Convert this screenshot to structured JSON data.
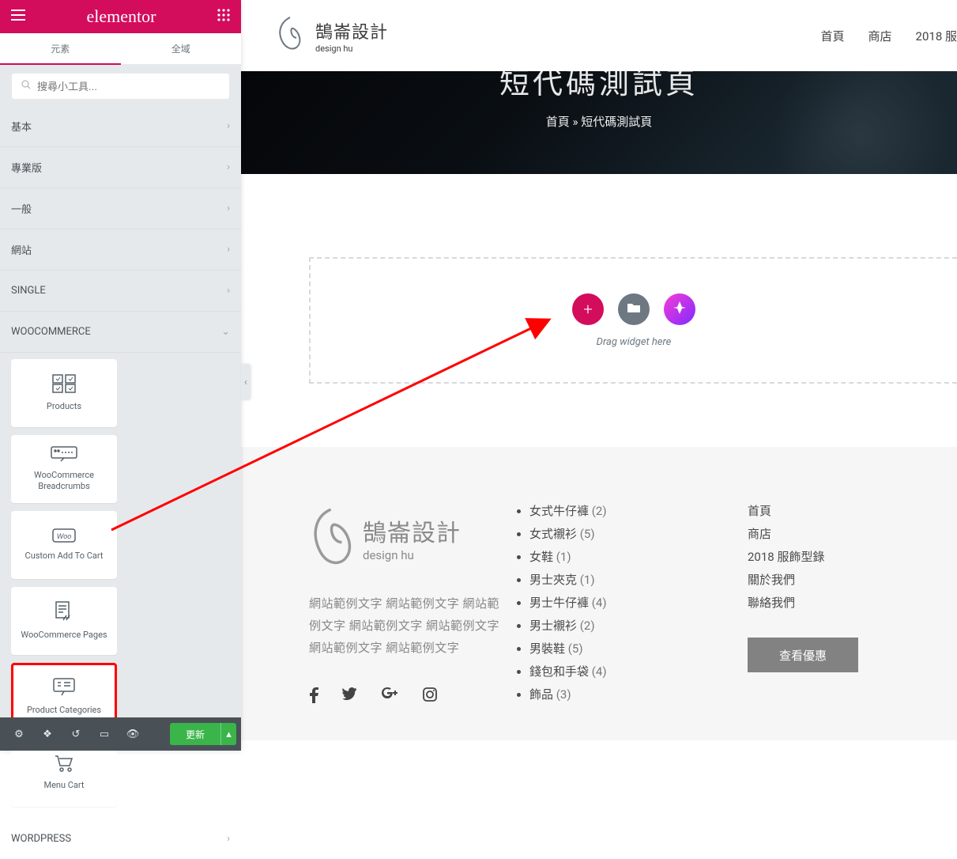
{
  "panel": {
    "logo": "elementor",
    "tabs": {
      "elements": "元素",
      "global": "全域"
    },
    "search_placeholder": "搜尋小工具...",
    "categories": {
      "basic": "基本",
      "pro": "專業版",
      "general": "一般",
      "site": "網站",
      "single": "SINGLE",
      "woocommerce": "WOOCOMMERCE",
      "wordpress": "WORDPRESS"
    },
    "widgets": {
      "products": "Products",
      "wc_breadcrumbs": "WooCommerce Breadcrumbs",
      "custom_cart": "Custom Add To Cart",
      "wc_pages": "WooCommerce Pages",
      "product_categories": "Product Categories",
      "menu_cart": "Menu Cart"
    },
    "footer": {
      "update": "更新"
    }
  },
  "site_header": {
    "logo_cn": "鵠崙設計",
    "logo_en": "design hu",
    "nav": {
      "home": "首頁",
      "shop": "商店",
      "catalog": "2018 服"
    }
  },
  "hero": {
    "title": "短代碼測試頁",
    "crumb_home": "首頁",
    "crumb_sep": " » ",
    "crumb_cur": "短代碼測試頁"
  },
  "editor": {
    "drop_msg": "Drag widget here"
  },
  "footer_section": {
    "logo_cn": "鵠崙設計",
    "logo_en": "design hu",
    "desc": "網站範例文字 網站範例文字 網站範例文字 網站範例文字 網站範例文字 網站範例文字 網站範例文字",
    "cat_list": [
      {
        "label": "女式牛仔褲",
        "count": "(2)"
      },
      {
        "label": "女式襯衫",
        "count": "(5)"
      },
      {
        "label": "女鞋",
        "count": "(1)"
      },
      {
        "label": "男士夾克",
        "count": "(1)"
      },
      {
        "label": "男士牛仔褲",
        "count": "(4)"
      },
      {
        "label": "男士襯衫",
        "count": "(2)"
      },
      {
        "label": "男裝鞋",
        "count": "(5)"
      },
      {
        "label": "錢包和手袋",
        "count": "(4)"
      },
      {
        "label": "飾品",
        "count": "(3)"
      }
    ],
    "nav_list": [
      "首頁",
      "商店",
      "2018 服飾型錄",
      "關於我們",
      "聯絡我們"
    ],
    "promo_btn": "查看優惠"
  }
}
